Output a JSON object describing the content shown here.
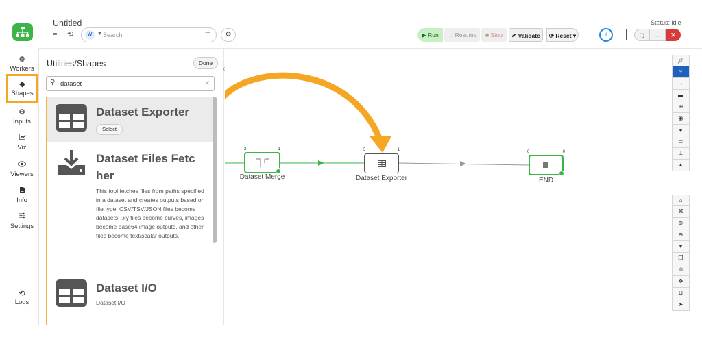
{
  "app": {
    "title": "Untitled",
    "status": "Status: idle"
  },
  "rail": {
    "items": [
      {
        "label": "Workers",
        "icon": "gear-icon"
      },
      {
        "label": "Shapes",
        "icon": "diamond-icon"
      },
      {
        "label": "Inputs",
        "icon": "cogs-icon"
      },
      {
        "label": "Viz",
        "icon": "chart-line-icon"
      },
      {
        "label": "Viewers",
        "icon": "eye-icon"
      },
      {
        "label": "Info",
        "icon": "file-icon"
      },
      {
        "label": "Settings",
        "icon": "sliders-icon"
      }
    ],
    "logs": "Logs"
  },
  "header": {
    "search_badge": "W",
    "search_placeholder": "Search"
  },
  "toolbar": {
    "run": "Run",
    "resume": "Resume",
    "stop": "Stop",
    "validate": "Validate",
    "reset": "Reset"
  },
  "panel": {
    "title": "Utilities/Shapes",
    "done": "Done",
    "search_value": "dataset",
    "items": [
      {
        "name": "Dataset Exporter",
        "select": "Select",
        "icon": "table-icon"
      },
      {
        "name_line1": "Dataset Files Fetc",
        "name_line2": "her",
        "icon": "download-icon",
        "description": "This tool fetches files from paths specified in a dataset and creates outputs based on file type. CSV/TSV/JSON files become datasets, .xy files become curves, images become base64 image outputs, and other files become text/scalar outputs."
      },
      {
        "name": "Dataset I/O",
        "description": "Dataset I/O",
        "icon": "table-icon"
      }
    ]
  },
  "canvas": {
    "nodes": [
      {
        "label": "Dataset Merge",
        "port_in": "2",
        "port_out": "1"
      },
      {
        "label": "Dataset Exporter",
        "port_in": "5",
        "port_out": "1"
      },
      {
        "label": "END",
        "port_in": "0",
        "port_out": "0"
      }
    ]
  },
  "colors": {
    "accent_green": "#3bb54a",
    "highlight_orange": "#f5a623",
    "tool_active_blue": "#1e5fbf",
    "close_red": "#d93a3a"
  }
}
